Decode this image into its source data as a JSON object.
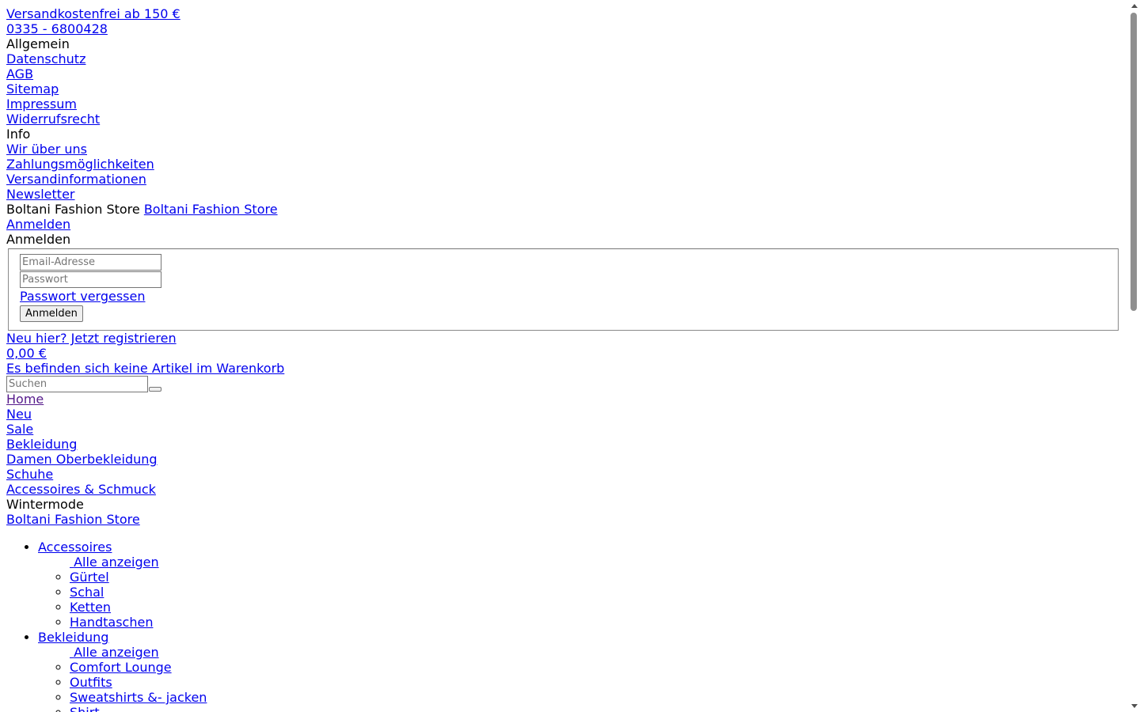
{
  "topbar": {
    "shipping_link": "Versandkostenfrei ab 150 €",
    "phone_link": "0335 - 6800428"
  },
  "footer_links": {
    "general_heading": "Allgemein",
    "general_items": [
      "Datenschutz",
      "AGB",
      "Sitemap",
      "Impressum",
      "Widerrufsrecht"
    ],
    "info_heading": "Info",
    "info_items": [
      "Wir über uns",
      "Zahlungsmöglichkeiten",
      "Versandinformationen",
      "Newsletter"
    ]
  },
  "brand": {
    "name": "Boltani Fashion Store",
    "logo_alt": "Boltani Fashion Store"
  },
  "account": {
    "login_link": "Anmelden",
    "login_legend": "Anmelden",
    "email_placeholder": "Email-Adresse",
    "password_placeholder": "Passwort",
    "forgot_link": "Passwort vergessen",
    "submit_label": "Anmelden",
    "register_link": "Neu hier? Jetzt registrieren"
  },
  "cart": {
    "total": "0,00 €",
    "empty_message": "Es befinden sich keine Artikel im Warenkorb"
  },
  "search": {
    "placeholder": "Suchen"
  },
  "nav": {
    "items": [
      "Home",
      "Neu",
      "Sale",
      "Bekleidung",
      "Damen Oberbekleidung",
      "Schuhe",
      "Accessoires & Schmuck"
    ],
    "static_item": "Wintermode"
  },
  "mobile_logo_alt": "Boltani Fashion Store",
  "menu": {
    "categories": [
      {
        "label": "Accessoires",
        "children": [
          "Alle anzeigen",
          "Gürtel",
          "Schal",
          "Ketten",
          "Handtaschen"
        ]
      },
      {
        "label": "Bekleidung",
        "children": [
          "Alle anzeigen",
          "Comfort Lounge",
          "Outfits",
          "Sweatshirts &- jacken",
          "Shirt"
        ]
      }
    ]
  }
}
